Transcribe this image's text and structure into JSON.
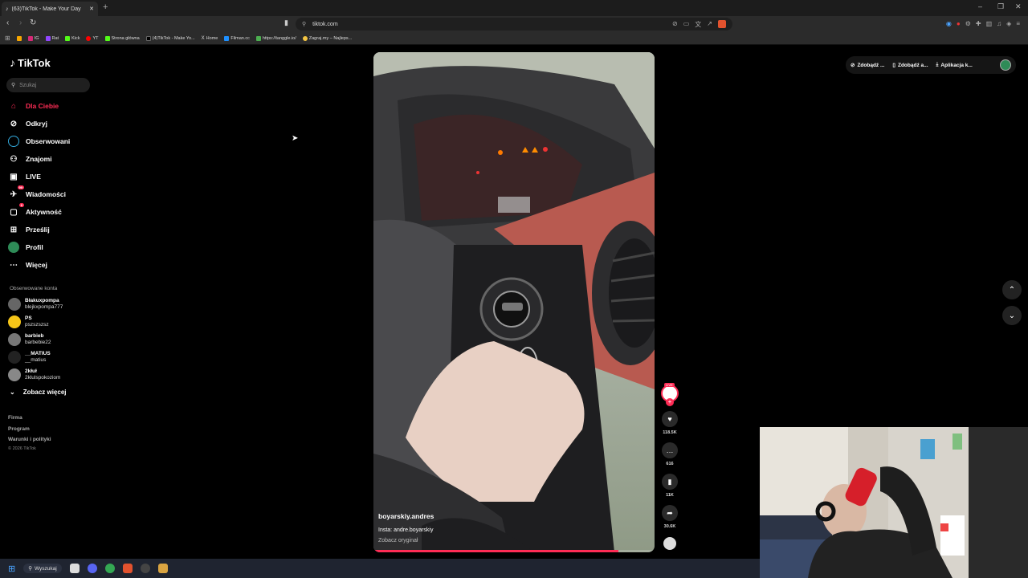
{
  "browser": {
    "tab_title": "(63)TikTok - Make Your Day",
    "url": "tiktok.com",
    "bookmarks": [
      "IG",
      "Rat",
      "Kick",
      "YT",
      "Strona główna",
      "(4)TikTok - Make Yo...",
      "Home",
      "Filman.cc",
      "https://tanggle.io/",
      "Zagraj.my – Najleps..."
    ]
  },
  "sidebar": {
    "logo": "TikTok",
    "search_placeholder": "Szukaj",
    "nav": [
      {
        "label": "Dla Ciebie"
      },
      {
        "label": "Odkryj"
      },
      {
        "label": "Obserwowani"
      },
      {
        "label": "Znajomi"
      },
      {
        "label": "LIVE"
      },
      {
        "label": "Wiadomości",
        "badge": "99"
      },
      {
        "label": "Aktywność",
        "badge": "6"
      },
      {
        "label": "Prześlij"
      },
      {
        "label": "Profil"
      },
      {
        "label": "Więcej"
      }
    ],
    "followed_title": "Obserwowane konta",
    "followed": [
      {
        "name": "Błakuxpompa",
        "user": "blejkxpompa777"
      },
      {
        "name": "PS",
        "user": "pszszszsz"
      },
      {
        "name": "barbieb",
        "user": "barbebie22"
      },
      {
        "name": "__MATIUS",
        "user": "__matius"
      },
      {
        "name": "2kłuł",
        "user": "2klulspokoziom"
      }
    ],
    "see_more": "Zobacz więcej",
    "footer": [
      "Firma",
      "Program",
      "Warunki i polityki"
    ],
    "copyright": "© 2026 TikTok"
  },
  "top_right": {
    "items": [
      "Zdobądź ...",
      "Zdobądź a...",
      "Aplikacja k..."
    ]
  },
  "video": {
    "author": "boyarskiy.andres",
    "description": "Insta: andre.boyarskiy",
    "see_original": "Zobacz oryginał",
    "progress": 0.87,
    "live_label": "LIVE",
    "likes": "118.5K",
    "comments": "616",
    "saves": "11K",
    "shares": "30.6K"
  },
  "taskbar": {
    "search": "Wyszukaj"
  }
}
